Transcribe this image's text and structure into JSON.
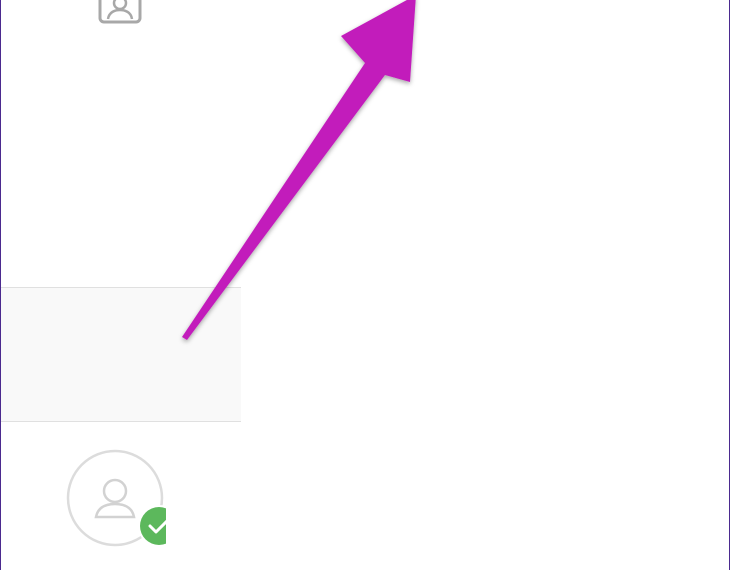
{
  "theme": {
    "accent": "#c21fbb",
    "check_badge": "#5cb85c",
    "icon_gray": "#a8a8a8",
    "divider": "#e0e0e0",
    "selected_row_bg": "#f9f9f9"
  },
  "sidebar": {
    "top_icon": "contact-card-icon",
    "items": [
      {
        "id": "contacts-panel"
      },
      {
        "id": "selected-row"
      },
      {
        "id": "profile-row",
        "avatar_icon": "user-icon",
        "badge_icon": "check-icon"
      }
    ]
  },
  "overlay": {
    "annotation": "arrow-icon"
  }
}
